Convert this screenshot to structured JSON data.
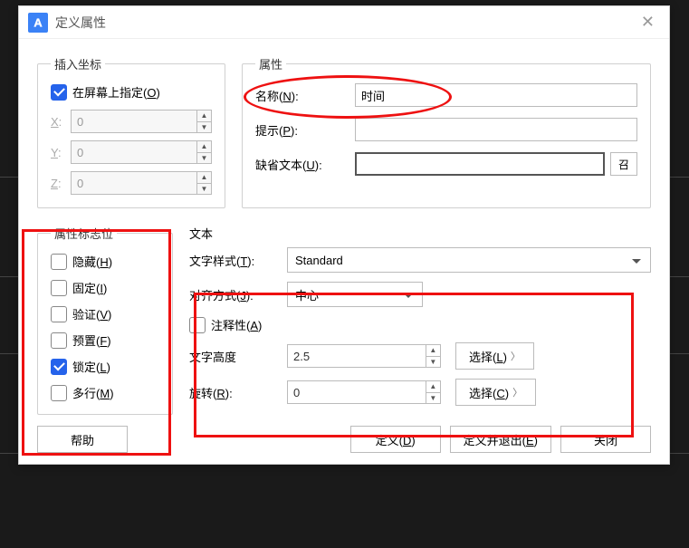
{
  "titlebar": {
    "title": "定义属性"
  },
  "insert_coords": {
    "legend": "插入坐标",
    "specify_on_screen_label": "在屏幕上指定(O)",
    "specify_on_screen_checked": true,
    "x_label": "X:",
    "x_value": "0",
    "y_label": "Y:",
    "y_value": "0",
    "z_label": "Z:",
    "z_value": "0"
  },
  "attrs": {
    "legend": "属性",
    "name_label": "名称(N):",
    "name_value": "时间",
    "prompt_label": "提示(P):",
    "prompt_value": "",
    "default_label": "缺省文本(U):",
    "default_value": ""
  },
  "flags": {
    "legend": "属性标志位",
    "hidden_label": "隐藏(H)",
    "hidden_checked": false,
    "fixed_label": "固定(I)",
    "fixed_checked": false,
    "verify_label": "验证(V)",
    "verify_checked": false,
    "preset_label": "预置(F)",
    "preset_checked": false,
    "lock_label": "锁定(L)",
    "lock_checked": true,
    "multiline_label": "多行(M)",
    "multiline_checked": false
  },
  "text_group": {
    "legend": "文本",
    "style_label": "文字样式(T):",
    "style_value": "Standard",
    "justify_label": "对齐方式(J):",
    "justify_value": "中心",
    "annotative_label": "注释性(A)",
    "annotative_checked": false,
    "height_label": "文字高度",
    "height_value": "2.5",
    "height_btn": "选择(L)",
    "rotation_label": "旋转(R):",
    "rotation_value": "0",
    "rotation_btn": "选择(C)"
  },
  "footer": {
    "help": "帮助",
    "define": "定义(D)",
    "define_exit": "定义并退出(E)",
    "close": "关闭"
  }
}
